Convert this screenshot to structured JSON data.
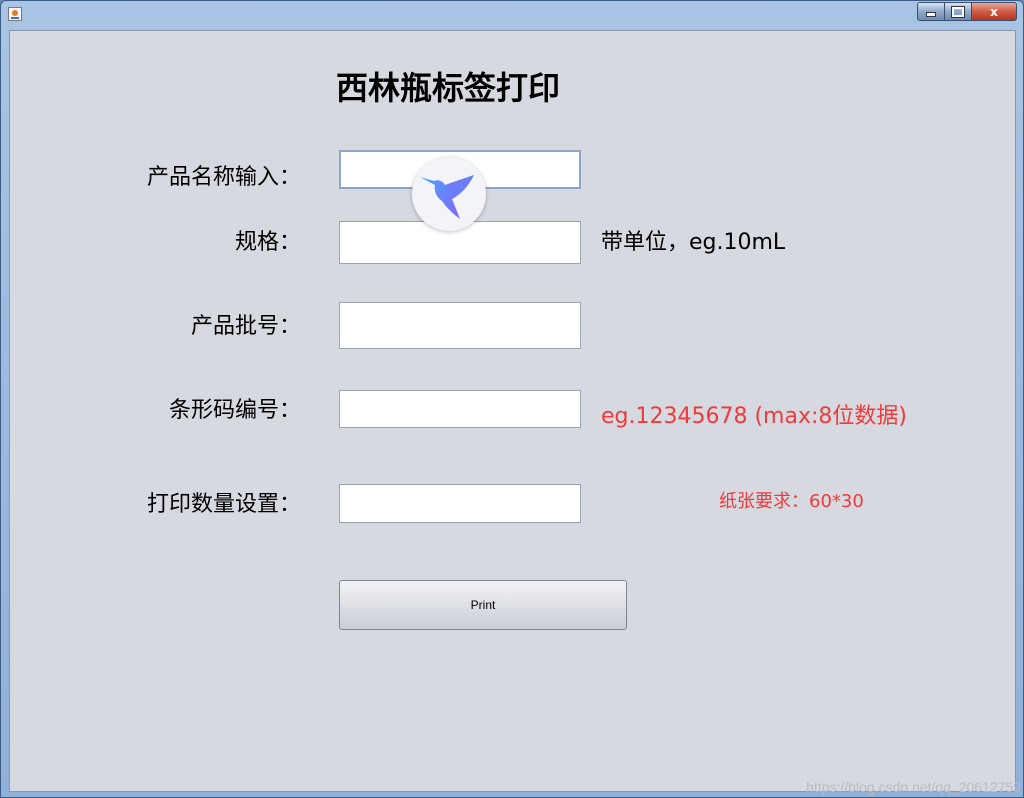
{
  "window": {
    "controls": {
      "minimize": "",
      "maximize": "",
      "close": "x"
    }
  },
  "form": {
    "title": "西林瓶标签打印",
    "fields": [
      {
        "label": "产品名称输入：",
        "value": "",
        "placeholder": ""
      },
      {
        "label": "规格：",
        "value": "",
        "placeholder": ""
      },
      {
        "label": "产品批号：",
        "value": "",
        "placeholder": ""
      },
      {
        "label": "条形码编号：",
        "value": "",
        "placeholder": ""
      },
      {
        "label": "打印数量设置：",
        "value": "",
        "placeholder": ""
      }
    ],
    "hints": {
      "spec": "带单位，eg.10mL",
      "barcode": "eg.12345678 (max:8位数据)",
      "paper": "纸张要求：60*30"
    },
    "print_label": "Print"
  },
  "overlay": {
    "icon": "hummingbird-icon"
  },
  "watermark": "https://blog.csdn.net/qq_20612759",
  "colors": {
    "background": "#d6d9e0",
    "hint_red": "#f03a3a",
    "bird_gradient": [
      "#4aa3ff",
      "#8b5cf6"
    ]
  }
}
